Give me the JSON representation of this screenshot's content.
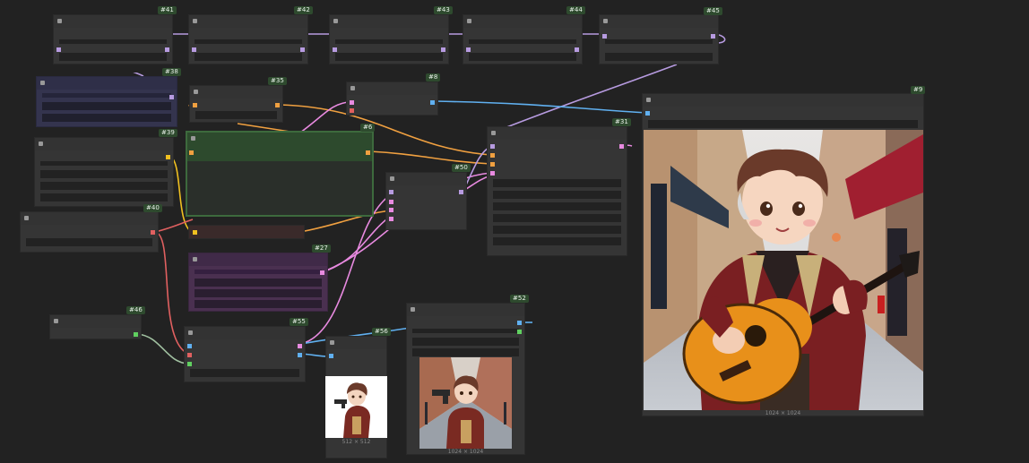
{
  "canvas": {
    "background": "#222222"
  },
  "nodes": [
    {
      "id": "41",
      "badge": "#41"
    },
    {
      "id": "42",
      "badge": "#42"
    },
    {
      "id": "43",
      "badge": "#43"
    },
    {
      "id": "44",
      "badge": "#44"
    },
    {
      "id": "45",
      "badge": "#45"
    },
    {
      "id": "38",
      "badge": "#38"
    },
    {
      "id": "35",
      "badge": "#35"
    },
    {
      "id": "8",
      "badge": "#8"
    },
    {
      "id": "9",
      "badge": "#9"
    },
    {
      "id": "39",
      "badge": "#39"
    },
    {
      "id": "6",
      "badge": "#6"
    },
    {
      "id": "31",
      "badge": "#31"
    },
    {
      "id": "50",
      "badge": "#50"
    },
    {
      "id": "40",
      "badge": "#40"
    },
    {
      "id": "27",
      "badge": "#27"
    },
    {
      "id": "46",
      "badge": "#46"
    },
    {
      "id": "55",
      "badge": "#55"
    },
    {
      "id": "56",
      "badge": "#56"
    },
    {
      "id": "52",
      "badge": "#52"
    }
  ],
  "images": {
    "node9": {
      "size_label": "1024 × 1024"
    },
    "node56": {
      "size_label": "512 × 512"
    },
    "node52": {
      "size_label": "1024 × 1024"
    }
  },
  "colors": {
    "wire_purple": "#b79be0",
    "wire_pink": "#e88ae0",
    "wire_orange": "#f0a040",
    "wire_yellow": "#f0c020",
    "wire_blue": "#60b0f0",
    "wire_red": "#e06060",
    "wire_green": "#a0c0a0",
    "node_green": "#2d4a2d",
    "node_purple": "#4a3050",
    "node_navy": "#34344e"
  }
}
